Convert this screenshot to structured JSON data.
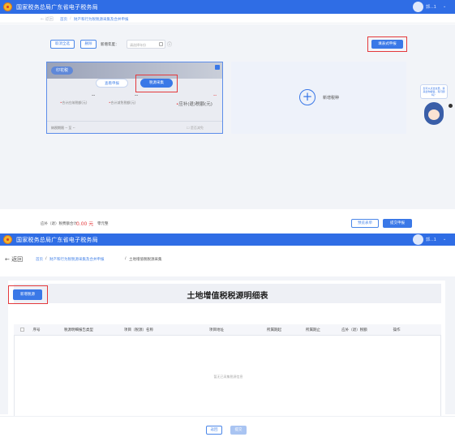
{
  "header": {
    "title": "国家税务总局广东省电子税务局",
    "user_name": "郭...1",
    "caret": "⌄"
  },
  "breadcrumb1": {
    "back": "← 返回",
    "home": "首页",
    "sep": "/",
    "current": "财产和行为税税源采集及合并申报"
  },
  "toolbar": {
    "select_all": "取消全选",
    "delete": "删除",
    "year_label": "新增年度：",
    "year_placeholder": "请选择年份",
    "info_icon": "ⓘ",
    "form_declare": "填表式申报"
  },
  "tax_card": {
    "name": "印花税",
    "btn_query": "查看申报",
    "btn_collect": "税源采集",
    "val1": "--",
    "val2": "--",
    "val3": "--",
    "label1_prefix": "•",
    "label1": "合计应纳税额(元)",
    "label2_prefix": "•",
    "label2": "合计减免税额(元)",
    "label3_prefix": "•",
    "label3": "应补(退)税额(元)",
    "period": "纳税期限 -- 至 --",
    "no_declare": "☐ 是否减免"
  },
  "add_card": {
    "plus": "+",
    "label": "新增税种"
  },
  "side_help": {
    "text": "您可以点击这里，我来给你解答，有问题吗？"
  },
  "bottom_bar": {
    "sum_label": "应补（退）税费额合计",
    "amount": "0.00 元",
    "unit": "零元整",
    "preview": "预览表单",
    "submit": "提交申报"
  },
  "breadcrumb2": {
    "back": "← 返回",
    "home": "首页",
    "sep1": "/",
    "middle": "财产和行为税税源采集及合并申报",
    "sep2": "/",
    "current": "土地增值税税源采集"
  },
  "detail": {
    "title": "土地增值税税源明细表",
    "add_button": "新增税源",
    "columns": [
      "序号",
      "税源明细报告类型",
      "项目（税源）名称",
      "项目地址",
      "所属期起",
      "所属期止",
      "应补（退）税额",
      "操作"
    ],
    "empty_text": "暂无已采集税源信息"
  },
  "footer": {
    "back": "返回",
    "submit": "提交"
  }
}
